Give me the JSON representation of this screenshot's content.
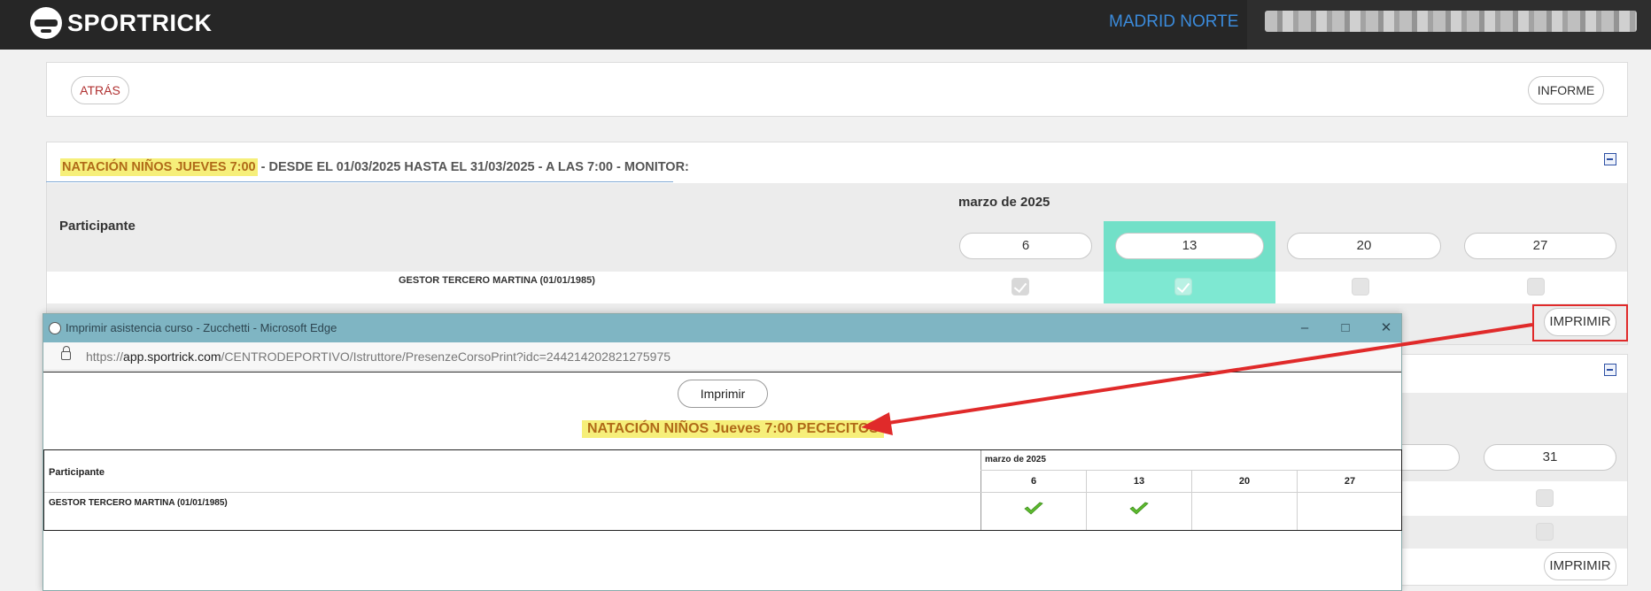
{
  "app": {
    "logo_text": "SPORTRICK",
    "center_name": "MADRID NORTE"
  },
  "toolbar": {
    "back_label": "ATRÁS",
    "report_label": "INFORME"
  },
  "course": {
    "title_highlight": "NATACIÓN NIÑOS JUEVES 7:00",
    "title_rest": " - DESDE EL 01/03/2025 HASTA EL 31/03/2025 - A LAS 7:00 - MONITOR:",
    "participant_header": "Participante",
    "month": "marzo de 2025",
    "dates": [
      "6",
      "13",
      "20",
      "27"
    ],
    "selected_date": "13",
    "participants": [
      {
        "name": "GESTOR TERCERO MARTINA (01/01/1985)",
        "attendance": [
          true,
          true,
          false,
          false
        ]
      }
    ],
    "print_label": "IMPRIMIR"
  },
  "course2": {
    "date_visible": "31",
    "print_label": "IMPRIMIR"
  },
  "popup": {
    "window_title": "Imprimir asistencia curso - Zucchetti - Microsoft Edge",
    "url_prefix": "https://",
    "url_host": "app.sportrick.com",
    "url_path": "/CENTRODEPORTIVO/Istruttore/PresenzeCorsoPrint?idc=244214202821275975",
    "print_button": "Imprimir",
    "print_title": "NATACIÓN NIÑOS Jueves 7:00 PECECITOS",
    "table": {
      "participant_header": "Participante",
      "month": "marzo de 2025",
      "dates": [
        "6",
        "13",
        "20",
        "27"
      ],
      "rows": [
        {
          "name": "GESTOR TERCERO MARTINA (01/01/1985)",
          "attendance": [
            true,
            true,
            false,
            false
          ]
        }
      ]
    }
  },
  "colors": {
    "accent_teal": "#7ee8d2",
    "highlight_yellow": "#f6ef7a",
    "annotation_red": "#e02a2a",
    "header_bg": "#262626",
    "center_blue": "#3b8bdb"
  }
}
